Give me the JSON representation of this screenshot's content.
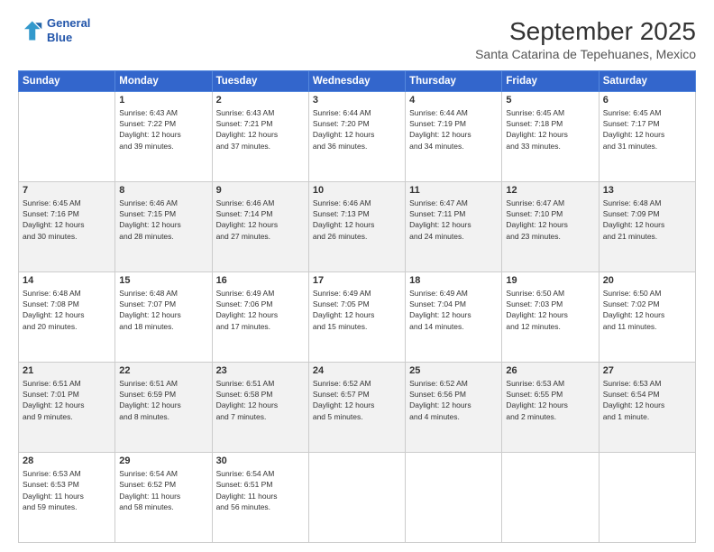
{
  "logo": {
    "line1": "General",
    "line2": "Blue"
  },
  "title": "September 2025",
  "subtitle": "Santa Catarina de Tepehuanes, Mexico",
  "weekdays": [
    "Sunday",
    "Monday",
    "Tuesday",
    "Wednesday",
    "Thursday",
    "Friday",
    "Saturday"
  ],
  "weeks": [
    [
      {
        "day": "",
        "info": ""
      },
      {
        "day": "1",
        "info": "Sunrise: 6:43 AM\nSunset: 7:22 PM\nDaylight: 12 hours\nand 39 minutes."
      },
      {
        "day": "2",
        "info": "Sunrise: 6:43 AM\nSunset: 7:21 PM\nDaylight: 12 hours\nand 37 minutes."
      },
      {
        "day": "3",
        "info": "Sunrise: 6:44 AM\nSunset: 7:20 PM\nDaylight: 12 hours\nand 36 minutes."
      },
      {
        "day": "4",
        "info": "Sunrise: 6:44 AM\nSunset: 7:19 PM\nDaylight: 12 hours\nand 34 minutes."
      },
      {
        "day": "5",
        "info": "Sunrise: 6:45 AM\nSunset: 7:18 PM\nDaylight: 12 hours\nand 33 minutes."
      },
      {
        "day": "6",
        "info": "Sunrise: 6:45 AM\nSunset: 7:17 PM\nDaylight: 12 hours\nand 31 minutes."
      }
    ],
    [
      {
        "day": "7",
        "info": "Sunrise: 6:45 AM\nSunset: 7:16 PM\nDaylight: 12 hours\nand 30 minutes."
      },
      {
        "day": "8",
        "info": "Sunrise: 6:46 AM\nSunset: 7:15 PM\nDaylight: 12 hours\nand 28 minutes."
      },
      {
        "day": "9",
        "info": "Sunrise: 6:46 AM\nSunset: 7:14 PM\nDaylight: 12 hours\nand 27 minutes."
      },
      {
        "day": "10",
        "info": "Sunrise: 6:46 AM\nSunset: 7:13 PM\nDaylight: 12 hours\nand 26 minutes."
      },
      {
        "day": "11",
        "info": "Sunrise: 6:47 AM\nSunset: 7:11 PM\nDaylight: 12 hours\nand 24 minutes."
      },
      {
        "day": "12",
        "info": "Sunrise: 6:47 AM\nSunset: 7:10 PM\nDaylight: 12 hours\nand 23 minutes."
      },
      {
        "day": "13",
        "info": "Sunrise: 6:48 AM\nSunset: 7:09 PM\nDaylight: 12 hours\nand 21 minutes."
      }
    ],
    [
      {
        "day": "14",
        "info": "Sunrise: 6:48 AM\nSunset: 7:08 PM\nDaylight: 12 hours\nand 20 minutes."
      },
      {
        "day": "15",
        "info": "Sunrise: 6:48 AM\nSunset: 7:07 PM\nDaylight: 12 hours\nand 18 minutes."
      },
      {
        "day": "16",
        "info": "Sunrise: 6:49 AM\nSunset: 7:06 PM\nDaylight: 12 hours\nand 17 minutes."
      },
      {
        "day": "17",
        "info": "Sunrise: 6:49 AM\nSunset: 7:05 PM\nDaylight: 12 hours\nand 15 minutes."
      },
      {
        "day": "18",
        "info": "Sunrise: 6:49 AM\nSunset: 7:04 PM\nDaylight: 12 hours\nand 14 minutes."
      },
      {
        "day": "19",
        "info": "Sunrise: 6:50 AM\nSunset: 7:03 PM\nDaylight: 12 hours\nand 12 minutes."
      },
      {
        "day": "20",
        "info": "Sunrise: 6:50 AM\nSunset: 7:02 PM\nDaylight: 12 hours\nand 11 minutes."
      }
    ],
    [
      {
        "day": "21",
        "info": "Sunrise: 6:51 AM\nSunset: 7:01 PM\nDaylight: 12 hours\nand 9 minutes."
      },
      {
        "day": "22",
        "info": "Sunrise: 6:51 AM\nSunset: 6:59 PM\nDaylight: 12 hours\nand 8 minutes."
      },
      {
        "day": "23",
        "info": "Sunrise: 6:51 AM\nSunset: 6:58 PM\nDaylight: 12 hours\nand 7 minutes."
      },
      {
        "day": "24",
        "info": "Sunrise: 6:52 AM\nSunset: 6:57 PM\nDaylight: 12 hours\nand 5 minutes."
      },
      {
        "day": "25",
        "info": "Sunrise: 6:52 AM\nSunset: 6:56 PM\nDaylight: 12 hours\nand 4 minutes."
      },
      {
        "day": "26",
        "info": "Sunrise: 6:53 AM\nSunset: 6:55 PM\nDaylight: 12 hours\nand 2 minutes."
      },
      {
        "day": "27",
        "info": "Sunrise: 6:53 AM\nSunset: 6:54 PM\nDaylight: 12 hours\nand 1 minute."
      }
    ],
    [
      {
        "day": "28",
        "info": "Sunrise: 6:53 AM\nSunset: 6:53 PM\nDaylight: 11 hours\nand 59 minutes."
      },
      {
        "day": "29",
        "info": "Sunrise: 6:54 AM\nSunset: 6:52 PM\nDaylight: 11 hours\nand 58 minutes."
      },
      {
        "day": "30",
        "info": "Sunrise: 6:54 AM\nSunset: 6:51 PM\nDaylight: 11 hours\nand 56 minutes."
      },
      {
        "day": "",
        "info": ""
      },
      {
        "day": "",
        "info": ""
      },
      {
        "day": "",
        "info": ""
      },
      {
        "day": "",
        "info": ""
      }
    ]
  ]
}
